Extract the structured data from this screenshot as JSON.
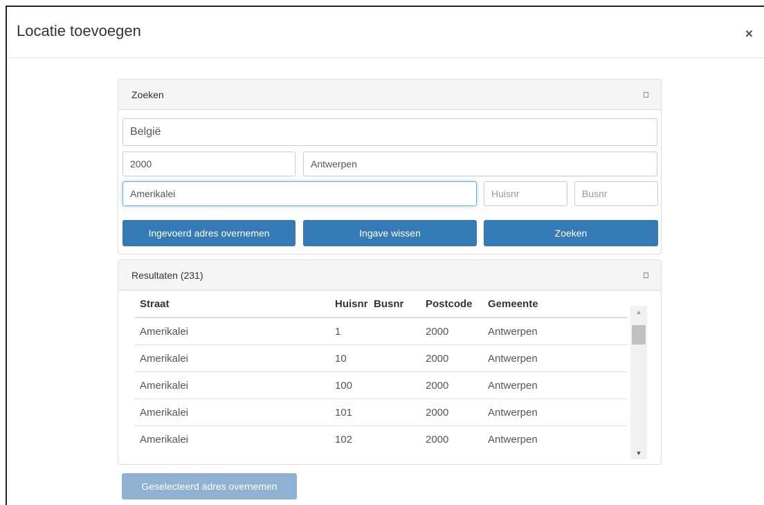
{
  "modal": {
    "title": "Locatie toevoegen",
    "close_label": "×"
  },
  "search_panel": {
    "title": "Zoeken",
    "country_value": "België",
    "postcode_value": "2000",
    "city_value": "Antwerpen",
    "street_value": "Amerikalei",
    "huisnr_placeholder": "Huisnr",
    "busnr_placeholder": "Busnr",
    "buttons": {
      "take_over": "Ingevoerd adres overnemen",
      "clear": "Ingave wissen",
      "search": "Zoeken"
    }
  },
  "results_panel": {
    "title": "Resultaten (231)",
    "columns": [
      "Straat",
      "Huisnr",
      "Busnr",
      "Postcode",
      "Gemeente"
    ],
    "rows": [
      [
        "Amerikalei",
        "1",
        "",
        "2000",
        "Antwerpen"
      ],
      [
        "Amerikalei",
        "10",
        "",
        "2000",
        "Antwerpen"
      ],
      [
        "Amerikalei",
        "100",
        "",
        "2000",
        "Antwerpen"
      ],
      [
        "Amerikalei",
        "101",
        "",
        "2000",
        "Antwerpen"
      ],
      [
        "Amerikalei",
        "102",
        "",
        "2000",
        "Antwerpen"
      ]
    ]
  },
  "footer": {
    "select_button": "Geselecteerd adres overnemen"
  },
  "icons": {
    "close": "close-icon",
    "collapse": "collapse-icon",
    "scroll_up": "scroll-up-arrow-icon",
    "scroll_down": "scroll-down-arrow-icon"
  },
  "colors": {
    "primary": "#337ab7",
    "primary_disabled": "#8fb2d3",
    "focus": "#66afe9"
  }
}
